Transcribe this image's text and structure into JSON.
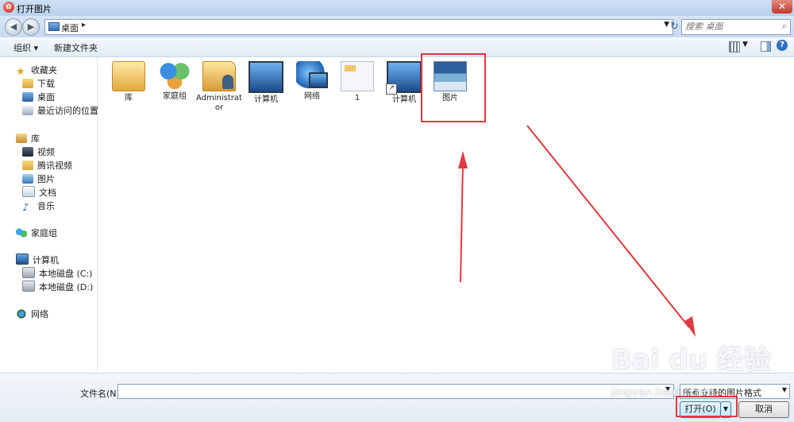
{
  "window": {
    "title": "打开图片",
    "app_icon": "red-circle-app-icon",
    "close_label": "✕"
  },
  "navigation": {
    "back_icon": "back-arrow-icon",
    "forward_icon": "forward-arrow-icon",
    "address": {
      "location": "桌面",
      "separator": "▸",
      "icon": "desktop-icon"
    },
    "refresh_icon": "refresh-icon",
    "search_placeholder": "搜索 桌面"
  },
  "toolbar": {
    "organize_label": "组织 ▾",
    "new_folder_label": "新建文件夹"
  },
  "sidebar": {
    "favorites": {
      "label": "收藏夹",
      "items": [
        "下载",
        "桌面",
        "最近访问的位置"
      ]
    },
    "libraries": {
      "label": "库",
      "items": [
        "视频",
        "腾讯视频",
        "图片",
        "文档",
        "音乐"
      ]
    },
    "homegroup": {
      "label": "家庭组"
    },
    "computer": {
      "label": "计算机",
      "items": [
        "本地磁盘 (C:)",
        "本地磁盘 (D:)"
      ]
    },
    "network": {
      "label": "网络"
    }
  },
  "files": [
    {
      "label": "库",
      "icon": "library-folder-icon"
    },
    {
      "label": "家庭组",
      "icon": "homegroup-icon"
    },
    {
      "label": "Administrator",
      "icon": "user-folder-icon"
    },
    {
      "label": "计算机",
      "icon": "computer-icon"
    },
    {
      "label": "网络",
      "icon": "network-icon"
    },
    {
      "label": "1",
      "icon": "document-icon"
    },
    {
      "label": "计算机",
      "icon": "computer-shortcut-icon"
    },
    {
      "label": "图片",
      "icon": "picture-icon"
    }
  ],
  "footer": {
    "filename_label": "文件名(N):",
    "filename_value": "",
    "filter_value": "所有支持的图片格式",
    "open_label": "打开(O)",
    "cancel_label": "取消"
  },
  "watermark": {
    "text": "Bai du 经验",
    "sub": "jingyan.baidu.com"
  },
  "colors": {
    "highlight": "#e0383e",
    "selection_blue": "#3c7fb1"
  }
}
